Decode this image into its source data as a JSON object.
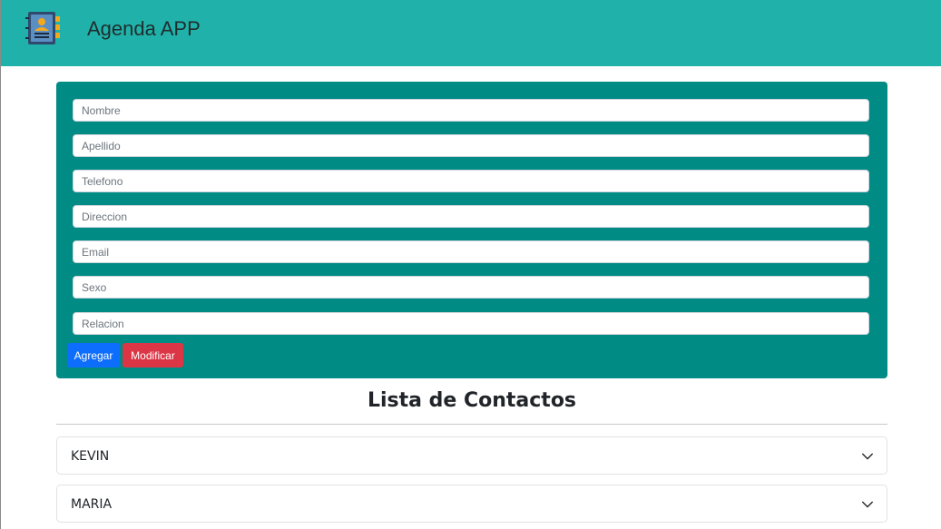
{
  "navbar": {
    "title": "Agenda APP",
    "logo_icon": "address-book-icon",
    "background": "#20b2aa"
  },
  "form": {
    "background": "#008b85",
    "fields": [
      {
        "name": "nombre",
        "placeholder": "Nombre",
        "value": ""
      },
      {
        "name": "apellido",
        "placeholder": "Apellido",
        "value": ""
      },
      {
        "name": "telefono",
        "placeholder": "Telefono",
        "value": ""
      },
      {
        "name": "direccion",
        "placeholder": "Direccion",
        "value": ""
      },
      {
        "name": "email",
        "placeholder": "Email",
        "value": ""
      },
      {
        "name": "sexo",
        "placeholder": "Sexo",
        "value": ""
      },
      {
        "name": "relacion",
        "placeholder": "Relacion",
        "value": ""
      }
    ],
    "buttons": {
      "add_label": "Agregar",
      "add_color": "#0d6efd",
      "modify_label": "Modificar",
      "modify_color": "#dc3545"
    }
  },
  "contacts": {
    "title": "Lista de Contactos",
    "items": [
      {
        "name": "KEVIN",
        "icon": "chevron-down-icon"
      },
      {
        "name": "MARIA",
        "icon": "chevron-down-icon"
      }
    ]
  }
}
